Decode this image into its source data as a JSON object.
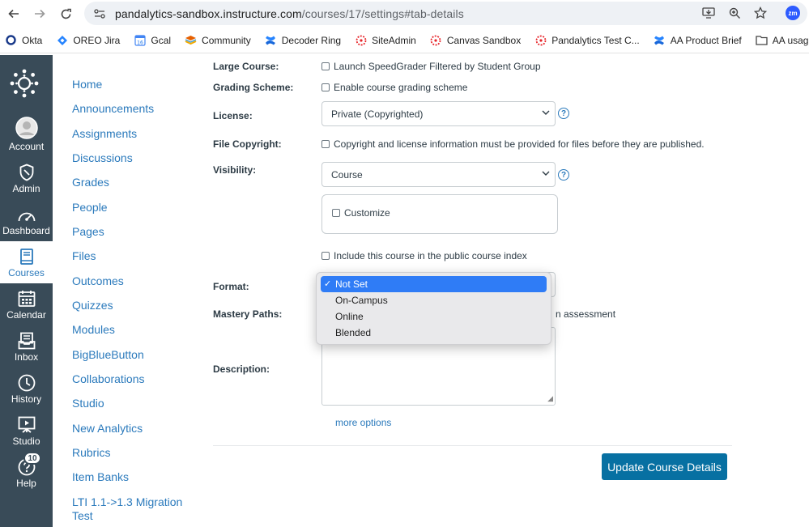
{
  "browser": {
    "url_host": "pandalytics-sandbox.instructure.com",
    "url_path": "/courses/17/settings#tab-details",
    "bookmarks": [
      {
        "label": "Okta",
        "icon": "okta-icon"
      },
      {
        "label": "OREO Jira",
        "icon": "jira-icon"
      },
      {
        "label": "Gcal",
        "icon": "calendar-icon"
      },
      {
        "label": "Community",
        "icon": "community-icon"
      },
      {
        "label": "Decoder Ring",
        "icon": "confluence-icon"
      },
      {
        "label": "SiteAdmin",
        "icon": "canvas-icon"
      },
      {
        "label": "Canvas Sandbox",
        "icon": "canvas-icon"
      },
      {
        "label": "Pandalytics Test C...",
        "icon": "canvas-icon"
      },
      {
        "label": "AA Product Brief",
        "icon": "confluence-icon"
      },
      {
        "label": "AA usage",
        "icon": "folder-icon"
      }
    ],
    "gcal_badge": "16",
    "profile_badge": "zm"
  },
  "global_nav": {
    "items": [
      {
        "label": "Account"
      },
      {
        "label": "Admin"
      },
      {
        "label": "Dashboard"
      },
      {
        "label": "Courses"
      },
      {
        "label": "Calendar"
      },
      {
        "label": "Inbox"
      },
      {
        "label": "History"
      },
      {
        "label": "Studio"
      },
      {
        "label": "Help",
        "badge": "10"
      }
    ],
    "active": "Courses"
  },
  "course_nav": {
    "items": [
      "Home",
      "Announcements",
      "Assignments",
      "Discussions",
      "Grades",
      "People",
      "Pages",
      "Files",
      "Outcomes",
      "Quizzes",
      "Modules",
      "BigBlueButton",
      "Collaborations",
      "Studio",
      "New Analytics",
      "Rubrics",
      "Item Banks",
      "LTI 1.1->1.3 Migration",
      "Test"
    ]
  },
  "settings": {
    "large_course_label": "Large Course:",
    "large_course_option": "Launch SpeedGrader Filtered by Student Group",
    "grading_scheme_label": "Grading Scheme:",
    "grading_scheme_option": "Enable course grading scheme",
    "license_label": "License:",
    "license_value": "Private (Copyrighted)",
    "file_copyright_label": "File Copyright:",
    "file_copyright_option": "Copyright and license information must be provided for files before they are published.",
    "visibility_label": "Visibility:",
    "visibility_value": "Course",
    "customize_option": "Customize",
    "public_index_option": "Include this course in the public course index",
    "format_label": "Format:",
    "format_options": [
      "Not Set",
      "On-Campus",
      "Online",
      "Blended"
    ],
    "format_selected": "Not Set",
    "mastery_label": "Mastery Paths:",
    "mastery_option_visible": "n assessment",
    "description_label": "Description:",
    "more_options": "more options",
    "update_button": "Update Course Details"
  },
  "colors": {
    "nav_bg": "#394b58",
    "link": "#2b7abc",
    "primary_button": "#0770a2",
    "dropdown_highlight": "#2f7cf6"
  }
}
